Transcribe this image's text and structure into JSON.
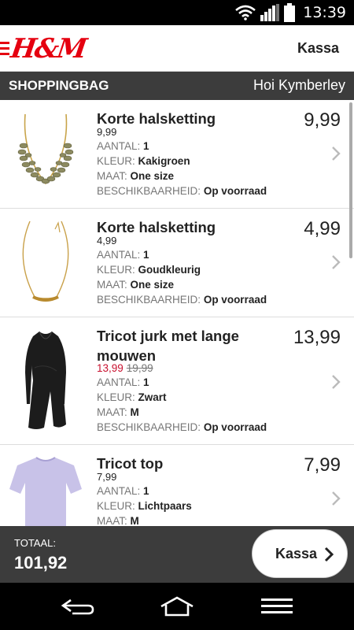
{
  "status": {
    "time": "13:39"
  },
  "app": {
    "logo": "H&M",
    "checkout_link": "Kassa"
  },
  "section": {
    "title": "SHOPPINGBAG",
    "greeting": "Hoi Kymberley"
  },
  "labels": {
    "quantity": "AANTAL:",
    "color": "KLEUR:",
    "size": "MAAT:",
    "availability": "BESCHIKBAARHEID:"
  },
  "items": [
    {
      "name": "Korte halsketting",
      "unit_price": "9,99",
      "quantity": "1",
      "color": "Kakigroen",
      "size": "One size",
      "availability": "Op voorraad",
      "total": "9,99"
    },
    {
      "name": "Korte halsketting",
      "unit_price": "4,99",
      "quantity": "1",
      "color": "Goudkleurig",
      "size": "One size",
      "availability": "Op voorraad",
      "total": "4,99"
    },
    {
      "name": "Tricot jurk met lange mouwen",
      "sale_price": "13,99",
      "old_price": "19,99",
      "quantity": "1",
      "color": "Zwart",
      "size": "M",
      "availability": "Op voorraad",
      "total": "13,99"
    },
    {
      "name": "Tricot top",
      "unit_price": "7,99",
      "quantity": "1",
      "color": "Lichtpaars",
      "size": "M",
      "total": "7,99"
    }
  ],
  "footer": {
    "total_label": "TOTAAL:",
    "total_value": "101,92",
    "checkout_button": "Kassa"
  },
  "colors": {
    "brand_red": "#e50010",
    "sale_red": "#c8102e",
    "dark_bar": "#3c3c3c"
  },
  "icons": {
    "wifi": "wifi-icon",
    "signal": "signal-icon",
    "battery": "battery-icon",
    "back": "back-icon",
    "home": "home-icon",
    "menu": "menu-icon",
    "chevron": "chevron-right-icon"
  }
}
